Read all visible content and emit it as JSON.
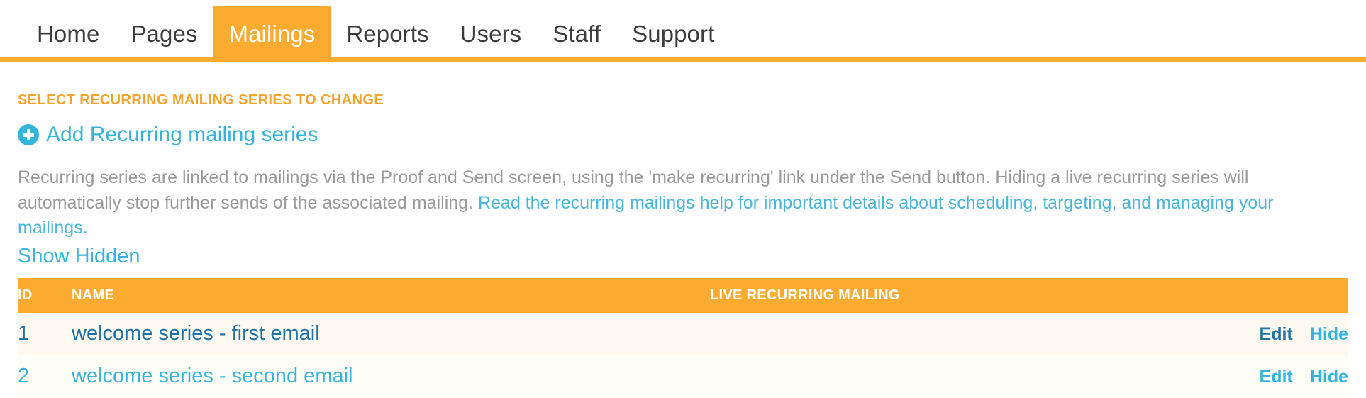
{
  "nav": {
    "tabs": [
      {
        "label": "Home",
        "active": false
      },
      {
        "label": "Pages",
        "active": false
      },
      {
        "label": "Mailings",
        "active": true
      },
      {
        "label": "Reports",
        "active": false
      },
      {
        "label": "Users",
        "active": false
      },
      {
        "label": "Staff",
        "active": false
      },
      {
        "label": "Support",
        "active": false
      }
    ]
  },
  "page": {
    "section_title": "SELECT RECURRING MAILING SERIES TO CHANGE",
    "add_link_label": "Add Recurring mailing series",
    "add_icon": "plus-circle-icon",
    "description_part1": "Recurring series are linked to mailings via the Proof and Send screen, using the 'make recurring' link under the Send button. Hiding a live recurring series will automatically stop further sends of the associated mailing. ",
    "description_link": "Read the recurring mailings help for important details about scheduling, targeting, and managing your mailings.",
    "show_hidden_label": "Show Hidden"
  },
  "table": {
    "columns": {
      "id": "ID",
      "name": "NAME",
      "live": "LIVE RECURRING MAILING",
      "actions": ""
    },
    "rows": [
      {
        "id": "1",
        "name": "welcome series - first email",
        "live": "",
        "edit_label": "Edit",
        "hide_label": "Hide",
        "name_state": "visited",
        "edit_state": "visited",
        "hide_state": "normal"
      },
      {
        "id": "2",
        "name": "welcome series - second email",
        "live": "",
        "edit_label": "Edit",
        "hide_label": "Hide",
        "name_state": "normal",
        "edit_state": "normal",
        "hide_state": "normal"
      }
    ]
  },
  "colors": {
    "accent_orange": "#fbab30",
    "heading_orange": "#f5a32a",
    "link_cyan": "#35b5dd",
    "link_visited_blue": "#1f72a5",
    "body_text_gray": "#9a9a9a",
    "row_odd_bg": "#fdf9f0",
    "row_even_bg": "#fffdf8"
  }
}
